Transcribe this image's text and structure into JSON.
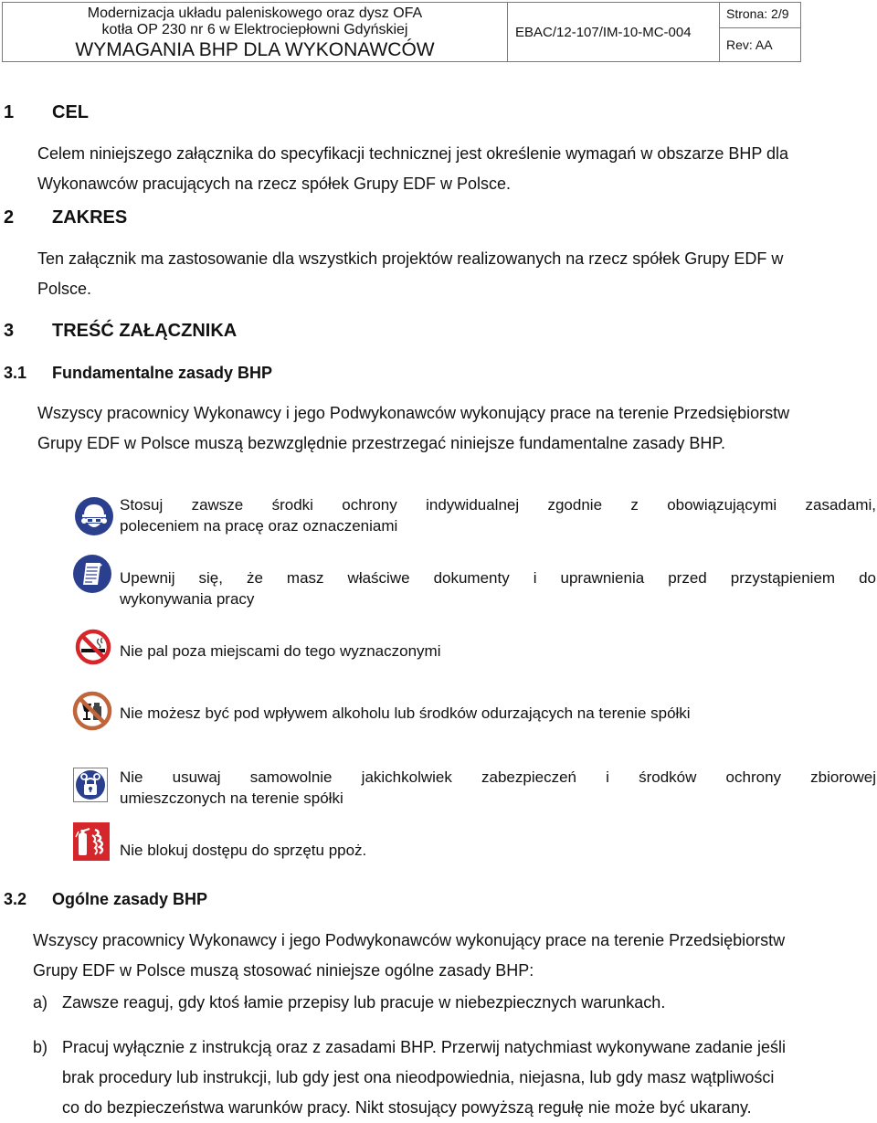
{
  "header": {
    "title_line1": "Modernizacja układu paleniskowego oraz dysz OFA",
    "title_line2": "kotła OP 230 nr 6 w  Elektrociepłowni Gdyńskiej",
    "title_line3": "WYMAGANIA BHP DLA WYKONAWCÓW",
    "document_number": "EBAC/12-107/IM-10-MC-004",
    "page": "Strona: 2/9",
    "revision": "Rev: AA"
  },
  "sections": {
    "cel": {
      "number": "1",
      "title": "CEL",
      "lines": [
        "Celem niniejszego załącznika do specyfikacji technicznej jest określenie wymagań w obszarze BHP dla",
        "Wykonawców pracujących na rzecz spółek Grupy EDF w Polsce."
      ]
    },
    "zakres": {
      "number": "2",
      "title": "ZAKRES",
      "lines": [
        "Ten załącznik ma zastosowanie dla wszystkich projektów realizowanych na rzecz spółek Grupy EDF w",
        "Polsce."
      ]
    },
    "tresc": {
      "number": "3",
      "title": "TREŚĆ ZAŁĄCZNIKA"
    },
    "fundamentalne": {
      "number": "3.1",
      "title": "Fundamentalne zasady BHP",
      "lines": [
        "Wszyscy pracownicy Wykonawcy i jego Podwykonawców wykonujący prace na terenie Przedsiębiorstw",
        "Grupy EDF w Polsce muszą bezwzględnie przestrzegać niniejsze fundamentalne zasady BHP."
      ],
      "rules": [
        {
          "icon": "ppe-helmet-icon",
          "line1": "Stosuj zawsze środki ochrony indywidualnej zgodnie z obowiązującymi zasadami,",
          "line2": "poleceniem na pracę oraz oznaczeniami"
        },
        {
          "icon": "document-icon",
          "line1": "Upewnij się, że masz właściwe dokumenty i uprawnienia przed przystąpieniem do",
          "line2": "wykonywania pracy"
        },
        {
          "icon": "no-smoking-icon",
          "line1": "Nie pal poza miejscami do tego wyznaczonymi",
          "line2": ""
        },
        {
          "icon": "no-alcohol-icon",
          "line1": "Nie możesz być pod wpływem alkoholu lub środków odurzających na terenie spółki",
          "line2": ""
        },
        {
          "icon": "padlock-icon",
          "line1": "Nie usuwaj samowolnie jakichkolwiek zabezpieczeń i środków ochrony zbiorowej",
          "line2": "umieszczonych na terenie spółki"
        },
        {
          "icon": "fire-extinguisher-icon",
          "line1": "Nie blokuj dostępu do sprzętu ppoż.",
          "line2": ""
        }
      ]
    },
    "ogolne": {
      "number": "3.2",
      "title": "Ogólne zasady BHP",
      "lines": [
        "Wszyscy pracownicy Wykonawcy i jego Podwykonawców wykonujący prace na terenie Przedsiębiorstw",
        "Grupy EDF w Polsce muszą stosować niniejsze ogólne zasady BHP:"
      ],
      "items": [
        {
          "marker": "a)",
          "lines": [
            "Zawsze reaguj, gdy ktoś łamie przepisy lub pracuje w niebezpiecznych warunkach."
          ]
        },
        {
          "marker": "b)",
          "lines": [
            "Pracuj wyłącznie z instrukcją oraz z zasadami BHP. Przerwij natychmiast wykonywane zadanie jeśli",
            "brak procedury lub instrukcji, lub gdy jest ona nieodpowiednia, niejasna, lub gdy masz wątpliwości",
            "co do bezpieczeństwa warunków pracy. Nikt stosujący powyższą regułę nie może być ukarany."
          ]
        }
      ]
    }
  },
  "colors": {
    "mandatory_blue": "#2b3f8f",
    "prohibition_red": "#d9242a",
    "prohibition_brown": "#c0643c",
    "fire_red": "#d5262b",
    "border_gray": "#7a7a7a"
  }
}
